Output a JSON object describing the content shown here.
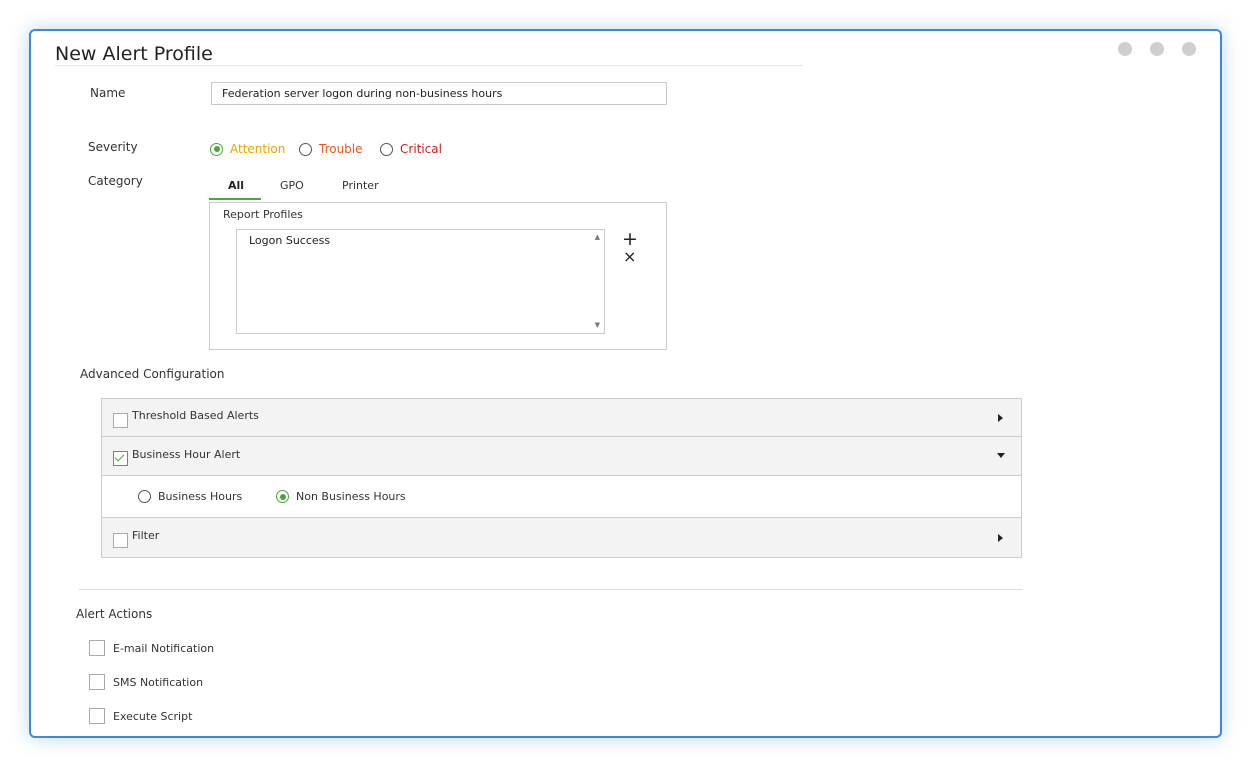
{
  "window": {
    "title": "New Alert Profile"
  },
  "form": {
    "name_label": "Name",
    "name_value": "Federation server logon during non-business hours",
    "severity_label": "Severity",
    "severity_options": [
      {
        "label": "Attention",
        "color": "#e8a400",
        "selected": true
      },
      {
        "label": "Trouble",
        "color": "#e8541f",
        "selected": false
      },
      {
        "label": "Critical",
        "color": "#cc1f1f",
        "selected": false
      }
    ],
    "category_label": "Category",
    "category_tabs": [
      "All",
      "GPO",
      "Printer"
    ],
    "active_tab": "All",
    "report_profiles_label": "Report Profiles",
    "report_profiles": [
      "Logon Success"
    ],
    "add_symbol": "+",
    "remove_symbol": "×"
  },
  "advanced": {
    "label": "Advanced Configuration",
    "threshold": {
      "label": "Threshold Based Alerts",
      "checked": false
    },
    "business_hour": {
      "label": "Business Hour Alert",
      "checked": true
    },
    "business_hours_options": [
      {
        "label": "Business Hours",
        "selected": false
      },
      {
        "label": "Non Business Hours",
        "selected": true
      }
    ],
    "filter": {
      "label": "Filter",
      "checked": false
    }
  },
  "alert_actions": {
    "label": "Alert Actions",
    "items": [
      {
        "label": "E-mail Notification",
        "checked": false
      },
      {
        "label": "SMS Notification",
        "checked": false
      },
      {
        "label": "Execute Script",
        "checked": false
      }
    ]
  },
  "colors": {
    "accent": "#4aa63a",
    "border": "#3d8ad6"
  }
}
